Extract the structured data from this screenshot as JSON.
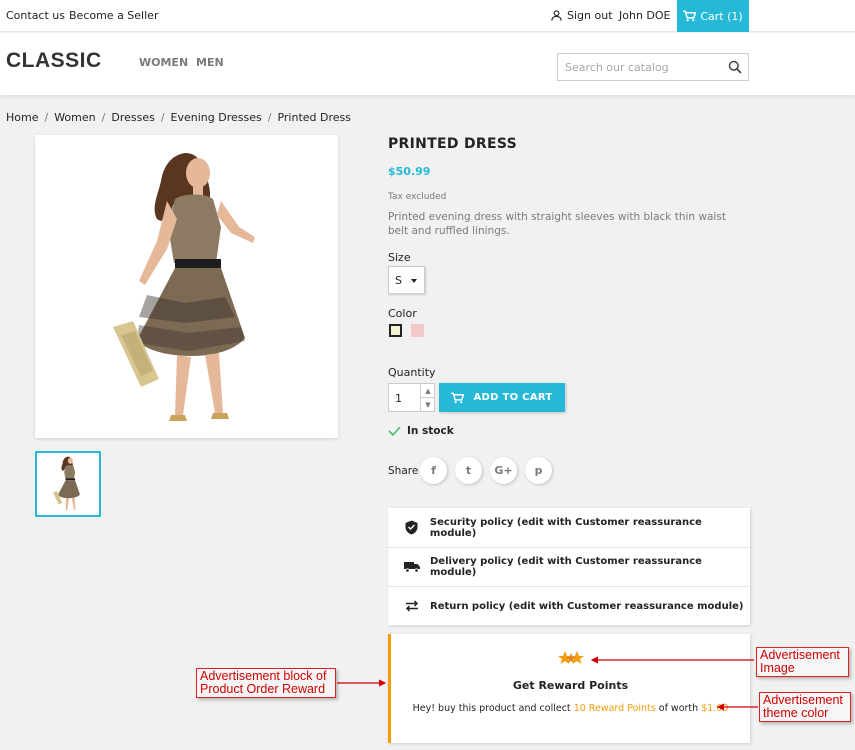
{
  "topbar": {
    "contact": "Contact us",
    "seller": "Become a Seller",
    "signout": "Sign out",
    "user": "John DOE",
    "cart": "Cart (1)"
  },
  "header": {
    "logo": "CLASSIC",
    "nav": [
      "WOMEN",
      "MEN"
    ],
    "search_placeholder": "Search our catalog"
  },
  "breadcrumb": [
    "Home",
    "Women",
    "Dresses",
    "Evening Dresses",
    "Printed Dress"
  ],
  "product": {
    "title": "PRINTED DRESS",
    "price": "$50.99",
    "tax": "Tax excluded",
    "description": "Printed evening dress with straight sleeves with black thin waist belt and ruffled linings.",
    "size_label": "Size",
    "size_value": "S",
    "color_label": "Color",
    "colors": [
      "#f3f3d2",
      "#f3c8c8"
    ],
    "quantity_label": "Quantity",
    "quantity": "1",
    "add_to_cart": "ADD TO CART",
    "stock": "In stock",
    "share_label": "Share"
  },
  "social": [
    "f",
    "t",
    "G+",
    "p"
  ],
  "reassurance": [
    {
      "icon": "shield-icon",
      "label": "Security policy (edit with Customer reassurance module)"
    },
    {
      "icon": "truck-icon",
      "label": "Delivery policy (edit with Customer reassurance module)"
    },
    {
      "icon": "exchange-icon",
      "label": "Return policy (edit with Customer reassurance module)"
    }
  ],
  "reward": {
    "title": "Get Reward Points",
    "text_a": "Hey! buy this product and collect ",
    "points": "10 Reward Points",
    "text_b": " of worth ",
    "worth": "$1.00"
  },
  "annotations": {
    "block": "Advertisement block of Product Order Reward",
    "image": "Advertisement Image",
    "theme": "Advertisement theme color"
  },
  "colors": {
    "accent": "#25b9d7",
    "reward": "#f39d0c",
    "annotation": "#d10000"
  }
}
